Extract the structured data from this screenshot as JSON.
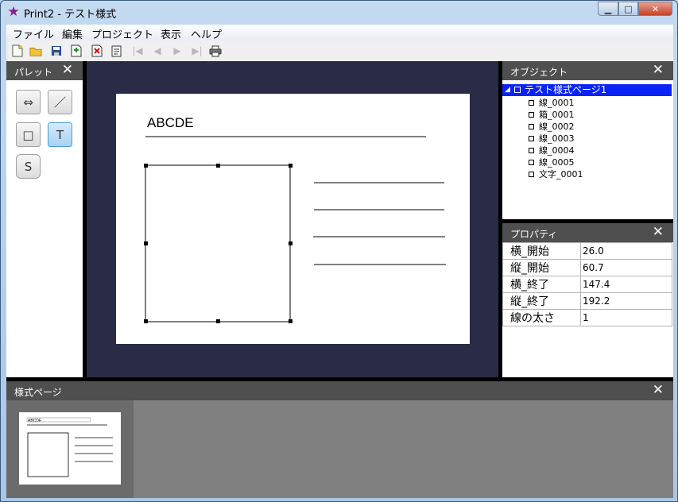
{
  "window": {
    "title": "Print2 - テスト様式",
    "minimize_glyph": "▁",
    "maximize_glyph": "□",
    "close_glyph": "✕"
  },
  "menu": [
    "ファイル",
    "編集",
    "プロジェクト",
    "表示",
    "ヘルプ"
  ],
  "toolbar_icons": [
    "new-icon",
    "open-folder-icon",
    "save-icon",
    "add-page-icon",
    "delete-page-icon",
    "properties-icon",
    "first-page-icon",
    "prev-page-icon",
    "next-page-icon",
    "last-page-icon",
    "print-icon"
  ],
  "palette": {
    "title": "パレット",
    "close": "✕",
    "tools": [
      {
        "name": "dimension-tool",
        "glyph": "⇔"
      },
      {
        "name": "line-tool",
        "glyph": "／"
      },
      {
        "name": "rectangle-tool",
        "glyph": "□"
      },
      {
        "name": "text-tool",
        "glyph": "T"
      },
      {
        "name": "s-tool",
        "glyph": "S"
      }
    ],
    "active_tool": "text-tool"
  },
  "canvas": {
    "text": "ABCDE",
    "background": "#2a2b47"
  },
  "objects": {
    "title": "オブジェクト",
    "close": "✕",
    "root_expander": "◢",
    "root": "テスト様式ページ1",
    "items": [
      "線_0001",
      "箱_0001",
      "線_0002",
      "線_0003",
      "線_0004",
      "線_0005",
      "文字_0001"
    ]
  },
  "properties": {
    "title": "プロパティ",
    "close": "✕",
    "rows": [
      {
        "key": "横_開始",
        "value": "26.0"
      },
      {
        "key": "縦_開始",
        "value": "60.7"
      },
      {
        "key": "横_終了",
        "value": "147.4"
      },
      {
        "key": "縦_終了",
        "value": "192.2"
      },
      {
        "key": "線の太さ",
        "value": "1"
      }
    ]
  },
  "pages": {
    "title": "様式ページ",
    "close": "✕",
    "thumb_text": "ABCDE"
  }
}
